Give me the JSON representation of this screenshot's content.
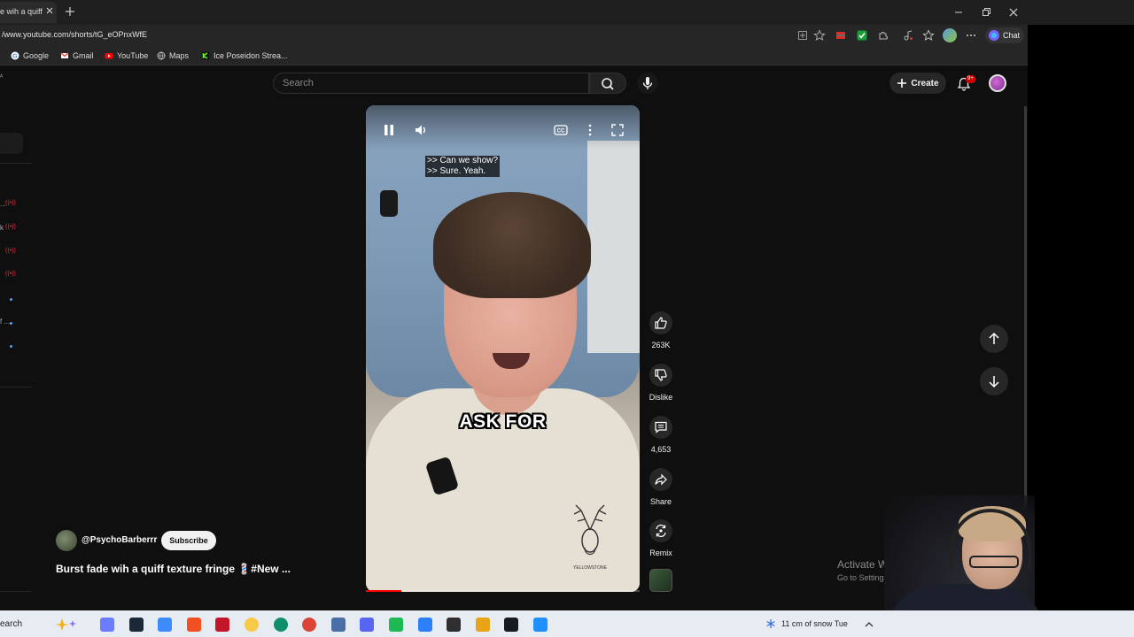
{
  "browser": {
    "tab_title": "e wih a quiff t",
    "url": "/www.youtube.com/shorts/tG_eOPnxWfE",
    "chat_label": "Chat",
    "bookmarks": [
      {
        "label": "Google",
        "icon": "google-icon",
        "color": "#4285f4"
      },
      {
        "label": "Gmail",
        "icon": "gmail-icon",
        "color": "#ea4335"
      },
      {
        "label": "YouTube",
        "icon": "youtube-icon",
        "color": "#ff0000"
      },
      {
        "label": "Maps",
        "icon": "globe-icon",
        "color": "#bbbbbb"
      },
      {
        "label": "Ice Poseidon Strea...",
        "icon": "kick-icon",
        "color": "#53fc18"
      }
    ]
  },
  "header": {
    "search_placeholder": "Search",
    "create_label": "Create",
    "notification_badge": "9+"
  },
  "left_rail": {
    "partial_texts": [
      "...",
      "k",
      "f ..."
    ]
  },
  "video": {
    "caption_text": ">> Can we show?\n>> Sure. Yeah.",
    "overlay_text": "ASK FOR",
    "progress_fraction": 0.13,
    "shirt_logo_text": "YELLOWSTONE"
  },
  "actions": {
    "like_count": "263K",
    "dislike_label": "Dislike",
    "comment_count": "4,653",
    "share_label": "Share",
    "remix_label": "Remix"
  },
  "channel": {
    "handle": "@PsychoBarberrr",
    "subscribe_label": "Subscribe",
    "video_title": "Burst fade wih a quiff texture fringe 💈#New ..."
  },
  "watermark": {
    "line1": "Activate Windows",
    "line2": "Go to Settings to activate"
  },
  "taskbar": {
    "search_label": "earch",
    "weather_text": "11 cm of snow Tue",
    "apps": [
      {
        "name": "copilot-icon",
        "color": "#6b7cff"
      },
      {
        "name": "steam-icon",
        "color": "#1b2838"
      },
      {
        "name": "copilot-app-icon",
        "color": "#3d8bff"
      },
      {
        "name": "ms-store-icon",
        "color": "#f25022"
      },
      {
        "name": "amd-icon",
        "color": "#c4162a"
      },
      {
        "name": "file-explorer-icon",
        "color": "#f7c948"
      },
      {
        "name": "edge-icon",
        "color": "#0c8f6a"
      },
      {
        "name": "chrome-icon",
        "color": "#db4437"
      },
      {
        "name": "app-icon-grid",
        "color": "#4a6fa5"
      },
      {
        "name": "discord-icon",
        "color": "#5865f2"
      },
      {
        "name": "spotify-icon",
        "color": "#1db954"
      },
      {
        "name": "app-icon-blue",
        "color": "#2d7ff9"
      },
      {
        "name": "obs-icon",
        "color": "#302e31"
      },
      {
        "name": "chrome-alt-icon",
        "color": "#e8a317"
      },
      {
        "name": "steam-alt-icon",
        "color": "#171a21"
      },
      {
        "name": "app-icon-cyan",
        "color": "#1e90ff"
      }
    ]
  },
  "colors": {
    "accent_red": "#ff0000",
    "page_bg": "#0f0f0f",
    "chip_bg": "#272727"
  }
}
